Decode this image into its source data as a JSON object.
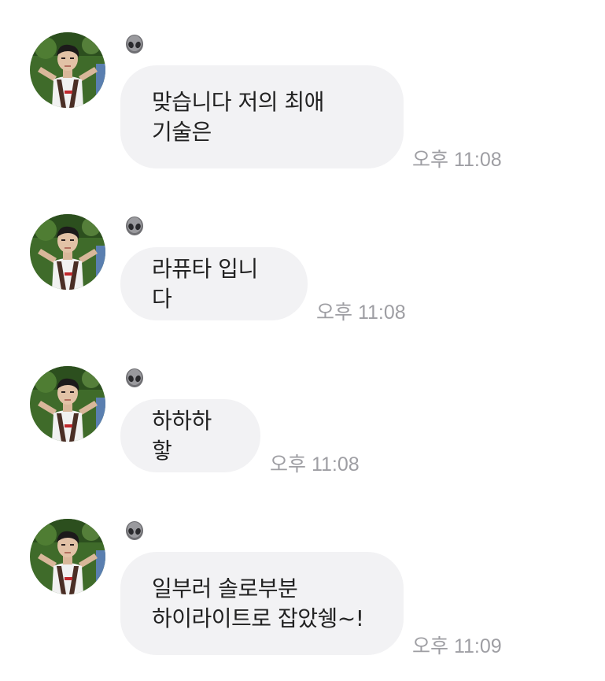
{
  "messages": [
    {
      "text": "맞습니다 저의 최애\n기술은",
      "time": "오후 11:08"
    },
    {
      "text": "라퓨타 입니다",
      "time": "오후 11:08"
    },
    {
      "text": "하하하핳",
      "time": "오후 11:08"
    },
    {
      "text": "일부러 솔로부분\n하이라이트로 잡았쉥~!",
      "time": "오후 11:09"
    }
  ],
  "sender_icon": "alien-icon",
  "avatar_icon": "profile-photo",
  "colors": {
    "bubble": "#f2f2f4",
    "text": "#222222",
    "time": "#9e9ea3"
  }
}
